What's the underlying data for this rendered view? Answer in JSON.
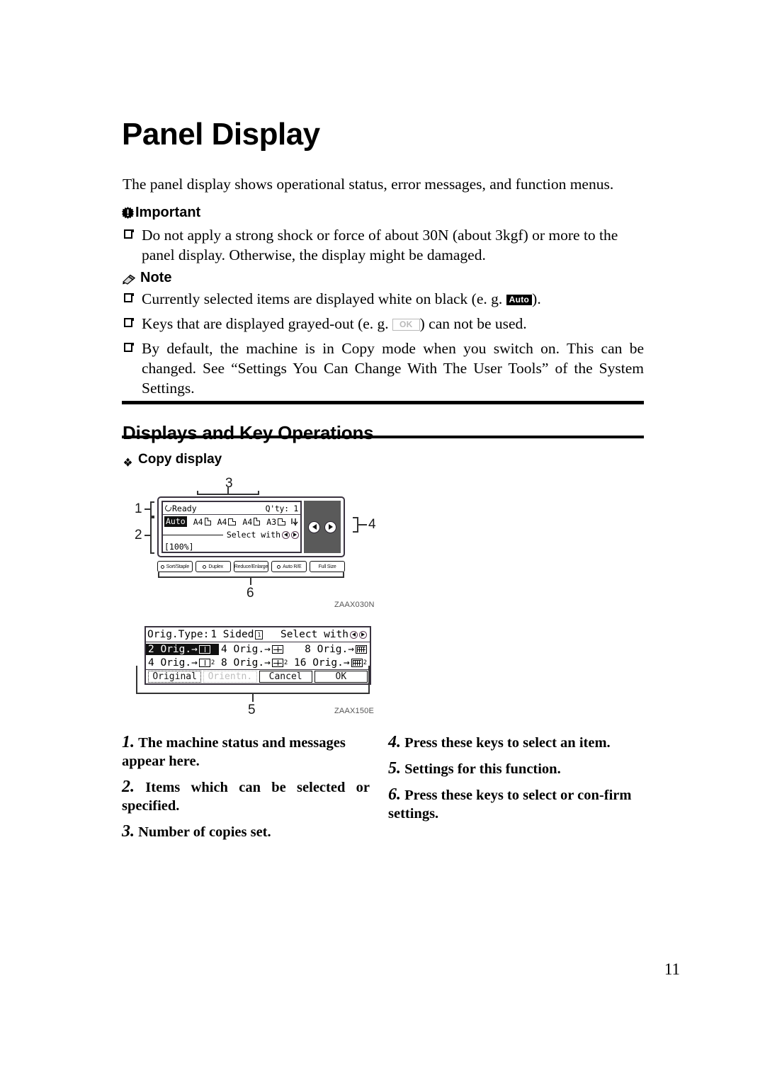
{
  "document": {
    "title": "Panel Display",
    "page_number": "11",
    "intro": "The panel display shows operational status, error messages, and function menus."
  },
  "important": {
    "heading": "Important",
    "icon": "important-icon",
    "items": [
      "Do not apply a strong shock or force of about 30N (about 3kgf) or more to the panel display. Otherwise, the display might be damaged."
    ]
  },
  "note": {
    "heading": "Note",
    "icon": "pencil-icon",
    "items": [
      {
        "before": "Currently selected items are displayed white on black (e. g. ",
        "chip": "Auto",
        "chip_style": "inverted",
        "after": ")."
      },
      {
        "before": "Keys that are displayed grayed-out (e. g. ",
        "chip": "OK",
        "chip_style": "grayed",
        "after": ") can not be used."
      },
      {
        "text": "By default, the machine is in Copy mode when you switch on. This can be changed. See “Settings You Can Change With The User Tools” of the System Settings."
      }
    ]
  },
  "section": {
    "title": "Displays and Key Operations",
    "subheading": "Copy display"
  },
  "figure1": {
    "id": "ZAAX030N",
    "callouts": [
      "1",
      "2",
      "3",
      "4",
      "6"
    ],
    "lcd": {
      "status": "Ready",
      "qty_label": "Q'ty:",
      "qty_value": "1",
      "paper_options": [
        {
          "label": "Auto",
          "selected": true,
          "glyph": ""
        },
        {
          "label": "A4",
          "selected": false,
          "glyph": "portrait-sheet-icon"
        },
        {
          "label": "A4",
          "selected": false,
          "glyph": "landscape-sheet-icon"
        },
        {
          "label": "A4",
          "selected": false,
          "glyph": "portrait-sheet-icon"
        },
        {
          "label": "A3",
          "selected": false,
          "glyph": "landscape-sheet-icon"
        },
        {
          "label": "",
          "selected": false,
          "glyph": "bypass-tray-icon"
        }
      ],
      "select_with": "Select with",
      "zoom": "[100%]"
    },
    "hardware_keys": [
      {
        "label": "Sort/Staple",
        "led": true
      },
      {
        "label": "Duplex",
        "led": true
      },
      {
        "label": "Reduce/Enlarge",
        "led": false
      },
      {
        "label": "Auto R/E",
        "led": true
      },
      {
        "label": "Full Size",
        "led": false
      }
    ]
  },
  "figure2": {
    "id": "ZAAX150E",
    "callouts": [
      "5"
    ],
    "header": {
      "label": "Orig.Type:",
      "value": "1 Sided",
      "value_glyph": "one-sided-icon",
      "select_with": "Select with"
    },
    "options": [
      {
        "label": "2 Orig.→",
        "glyph": "g2",
        "sub": "",
        "selected": true
      },
      {
        "label": "4 Orig.→",
        "glyph": "g4",
        "sub": "",
        "selected": false
      },
      {
        "label": "8 Orig.→",
        "glyph": "g8",
        "sub": "",
        "selected": false
      },
      {
        "label": "4 Orig.→",
        "glyph": "g2",
        "sub": "2",
        "selected": false
      },
      {
        "label": "8 Orig.→",
        "glyph": "g4",
        "sub": "2",
        "selected": false
      },
      {
        "label": "16 Orig.→",
        "glyph": "g8",
        "sub": "2",
        "selected": false
      }
    ],
    "buttons": [
      {
        "label": "Original",
        "state": "normal"
      },
      {
        "label": "Orientn.",
        "state": "grayed"
      },
      {
        "label": "Cancel",
        "state": "normal"
      },
      {
        "label": "OK",
        "state": "normal"
      }
    ]
  },
  "explanations": {
    "left": [
      {
        "num": "1.",
        "text": "The machine status and messages appear here."
      },
      {
        "num": "2.",
        "text": "Items which can be selected or specified."
      },
      {
        "num": "3.",
        "text": "Number of copies set."
      }
    ],
    "right": [
      {
        "num": "4.",
        "text": "Press these keys to select an item."
      },
      {
        "num": "5.",
        "text": "Settings for this function."
      },
      {
        "num": "6.",
        "text": "Press these keys to select or con-firm settings."
      }
    ]
  }
}
